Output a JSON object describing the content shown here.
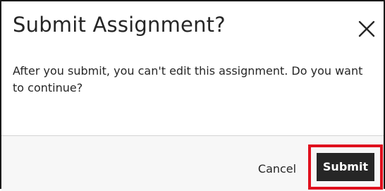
{
  "dialog": {
    "title": "Submit Assignment?",
    "close_icon": "close-icon",
    "message": "After you submit, you can't edit this assignment. Do you want to continue?"
  },
  "footer": {
    "cancel_label": "Cancel",
    "submit_label": "Submit"
  },
  "colors": {
    "highlight_border": "#e0101e",
    "primary_button": "#262626",
    "footer_background": "#f7f7f7"
  }
}
